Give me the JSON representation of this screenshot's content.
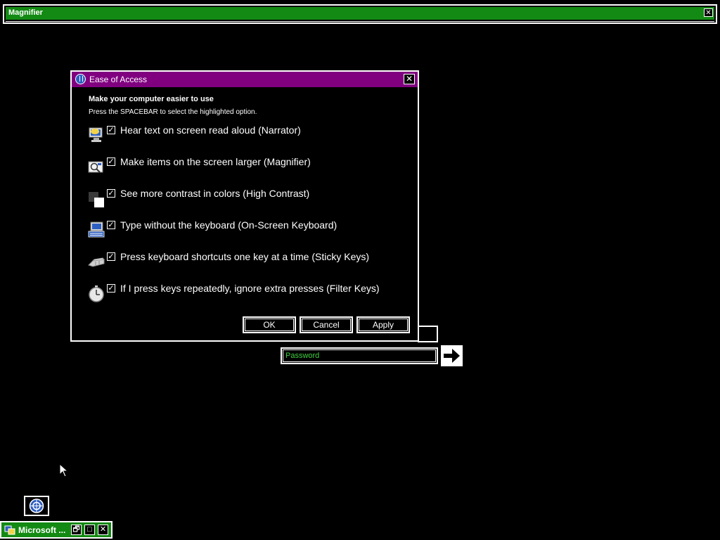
{
  "magnifier": {
    "title": "Magnifier",
    "close": "✕"
  },
  "dialog": {
    "title": "Ease of Access",
    "close": "✕",
    "heading": "Make your computer easier to use",
    "subheading": "Press the SPACEBAR to select the highlighted option.",
    "options": [
      {
        "label": "Hear text on screen read aloud (Narrator)",
        "checked": true,
        "icon": "narrator-icon"
      },
      {
        "label": "Make items on the screen larger (Magnifier)",
        "checked": true,
        "icon": "magnifier-icon"
      },
      {
        "label": "See more contrast in colors (High Contrast)",
        "checked": true,
        "icon": "high-contrast-icon"
      },
      {
        "label": "Type without the keyboard (On-Screen Keyboard)",
        "checked": true,
        "icon": "on-screen-keyboard-icon"
      },
      {
        "label": "Press keyboard shortcuts one key at a time (Sticky Keys)",
        "checked": true,
        "icon": "sticky-keys-icon"
      },
      {
        "label": "If I press keys repeatedly, ignore extra presses (Filter Keys)",
        "checked": true,
        "icon": "filter-keys-icon"
      }
    ],
    "check_glyph": "✓",
    "buttons": {
      "ok": "OK",
      "cancel": "Cancel",
      "apply": "Apply"
    }
  },
  "login": {
    "password_placeholder": "Password",
    "go": "→"
  },
  "taskbar": {
    "item": "Microsoft ...",
    "restore": "🗗",
    "maximize": "□",
    "close": "✕"
  },
  "colors": {
    "accent_green": "#138a13",
    "dialog_title": "#800080",
    "field_text": "#3fd13f"
  }
}
